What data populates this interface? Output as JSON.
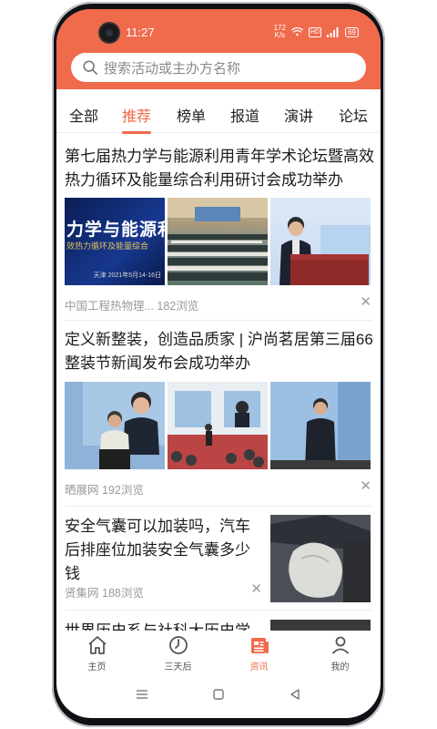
{
  "status": {
    "time": "11:27",
    "network": "4G",
    "speed": "172\nK/s",
    "battery": "69"
  },
  "search": {
    "placeholder": "搜索活动或主办方名称"
  },
  "tabs": [
    {
      "label": "全部",
      "active": false
    },
    {
      "label": "推荐",
      "active": true
    },
    {
      "label": "榜单",
      "active": false
    },
    {
      "label": "报道",
      "active": false
    },
    {
      "label": "演讲",
      "active": false
    },
    {
      "label": "论坛",
      "active": false
    }
  ],
  "feed": [
    {
      "title": "第七届热力学与能源利用青年学术论坛暨高效热力循环及能量综合利用研讨会成功举办",
      "images": [
        "banner-thermodynamics",
        "conference-hall",
        "speaker-podium"
      ],
      "banner_text": "力学与能源利用",
      "banner_sub": "效热力循环及能量综合",
      "banner_date": "天津 2021年5月14-16日",
      "source": "中国工程热物理...",
      "views": "182浏览"
    },
    {
      "title": "定义新整装，创造品质家 | 沪尚茗居第三届66整装节新闻发布会成功举办",
      "images": [
        "stage-speaker-1",
        "audience-stage",
        "stage-speaker-2"
      ],
      "source": "晒展网",
      "views": "192浏览"
    },
    {
      "title": "安全气囊可以加装吗，汽车后排座位加装安全气囊多少钱",
      "images": [
        "airbag-photo"
      ],
      "source": "贤集网",
      "views": "188浏览"
    },
    {
      "title": "世界历史系与社科大历史学院",
      "images": [
        "history-photo"
      ]
    }
  ],
  "bottom_nav": [
    {
      "label": "主页",
      "icon": "home-icon",
      "active": false
    },
    {
      "label": "三天后",
      "icon": "clock-icon",
      "active": false
    },
    {
      "label": "资讯",
      "icon": "news-icon",
      "active": true
    },
    {
      "label": "我的",
      "icon": "profile-icon",
      "active": false
    }
  ],
  "colors": {
    "accent": "#f06a4c",
    "text": "#1c1c1c",
    "muted": "#9a9a9a"
  }
}
